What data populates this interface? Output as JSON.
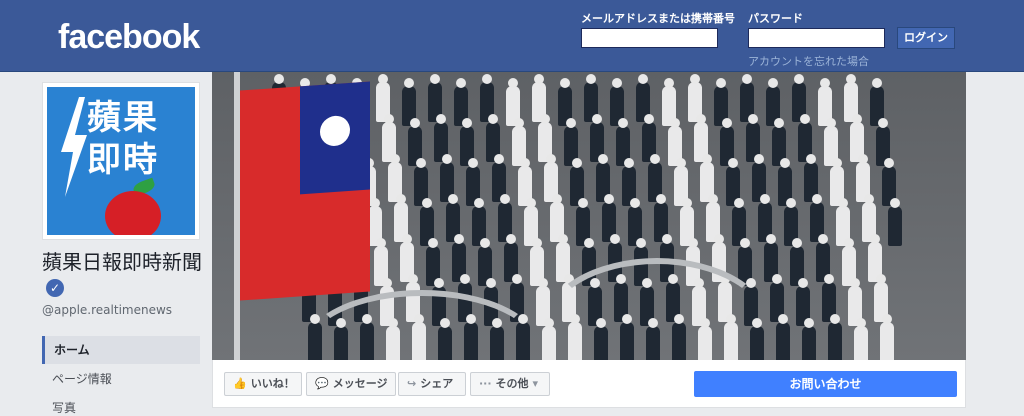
{
  "header": {
    "logo": "facebook",
    "email_label": "メールアドレスまたは携帯番号",
    "password_label": "パスワード",
    "login_button": "ログイン",
    "forgot_link": "アカウントを忘れた場合"
  },
  "page": {
    "name": "蘋果日報即時新聞",
    "handle": "@apple.realtimenews",
    "profile_text_line1": "蘋果",
    "profile_text_line2": "即時",
    "verified_icon": "check-icon"
  },
  "nav": {
    "items": [
      {
        "label": "ホーム",
        "active": true
      },
      {
        "label": "ページ情報",
        "active": false
      },
      {
        "label": "写真",
        "active": false
      }
    ]
  },
  "actions": {
    "like": "いいね！",
    "message": "メッセージ",
    "share": "シェア",
    "more": "その他",
    "contact": "お問い合わせ"
  },
  "colors": {
    "brand": "#3b5998",
    "accent": "#4080ff",
    "flag_red": "#d82b2b",
    "flag_blue": "#1f2f8c"
  }
}
